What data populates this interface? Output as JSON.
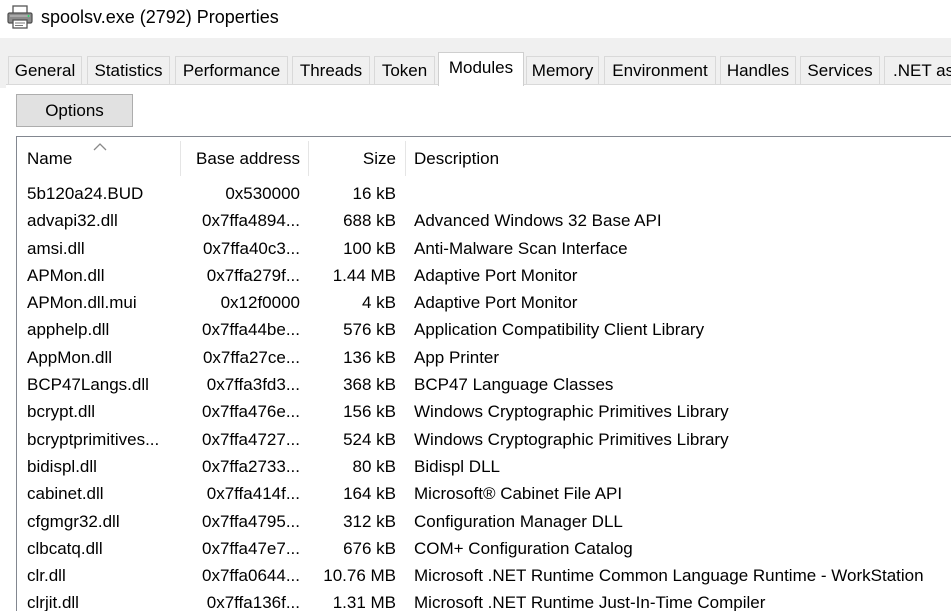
{
  "window": {
    "title": "spoolsv.exe (2792) Properties",
    "icon": "printer-icon"
  },
  "tabs": [
    {
      "label": "General",
      "active": false
    },
    {
      "label": "Statistics",
      "active": false
    },
    {
      "label": "Performance",
      "active": false
    },
    {
      "label": "Threads",
      "active": false
    },
    {
      "label": "Token",
      "active": false
    },
    {
      "label": "Modules",
      "active": true
    },
    {
      "label": "Memory",
      "active": false
    },
    {
      "label": "Environment",
      "active": false
    },
    {
      "label": "Handles",
      "active": false
    },
    {
      "label": "Services",
      "active": false
    },
    {
      "label": ".NET as",
      "active": false
    }
  ],
  "toolbar": {
    "options_label": "Options"
  },
  "table": {
    "columns": {
      "name": "Name",
      "base_address": "Base address",
      "size": "Size",
      "description": "Description"
    },
    "sort_indicator": "sort-ascending-icon",
    "rows": [
      {
        "name": "5b120a24.BUD",
        "base": "0x530000",
        "size": "16 kB",
        "description": ""
      },
      {
        "name": "advapi32.dll",
        "base": "0x7ffa4894...",
        "size": "688 kB",
        "description": "Advanced Windows 32 Base API"
      },
      {
        "name": "amsi.dll",
        "base": "0x7ffa40c3...",
        "size": "100 kB",
        "description": "Anti-Malware Scan Interface"
      },
      {
        "name": "APMon.dll",
        "base": "0x7ffa279f...",
        "size": "1.44 MB",
        "description": "Adaptive Port Monitor"
      },
      {
        "name": "APMon.dll.mui",
        "base": "0x12f0000",
        "size": "4 kB",
        "description": "Adaptive Port Monitor"
      },
      {
        "name": "apphelp.dll",
        "base": "0x7ffa44be...",
        "size": "576 kB",
        "description": "Application Compatibility Client Library"
      },
      {
        "name": "AppMon.dll",
        "base": "0x7ffa27ce...",
        "size": "136 kB",
        "description": "App Printer"
      },
      {
        "name": "BCP47Langs.dll",
        "base": "0x7ffa3fd3...",
        "size": "368 kB",
        "description": "BCP47 Language Classes"
      },
      {
        "name": "bcrypt.dll",
        "base": "0x7ffa476e...",
        "size": "156 kB",
        "description": "Windows Cryptographic Primitives Library"
      },
      {
        "name": "bcryptprimitives...",
        "base": "0x7ffa4727...",
        "size": "524 kB",
        "description": "Windows Cryptographic Primitives Library"
      },
      {
        "name": "bidispl.dll",
        "base": "0x7ffa2733...",
        "size": "80 kB",
        "description": "Bidispl DLL"
      },
      {
        "name": "cabinet.dll",
        "base": "0x7ffa414f...",
        "size": "164 kB",
        "description": "Microsoft® Cabinet File API"
      },
      {
        "name": "cfgmgr32.dll",
        "base": "0x7ffa4795...",
        "size": "312 kB",
        "description": "Configuration Manager DLL"
      },
      {
        "name": "clbcatq.dll",
        "base": "0x7ffa47e7...",
        "size": "676 kB",
        "description": "COM+ Configuration Catalog"
      },
      {
        "name": "clr.dll",
        "base": "0x7ffa0644...",
        "size": "10.76 MB",
        "description": "Microsoft .NET Runtime Common Language Runtime - WorkStation"
      },
      {
        "name": "clrjit.dll",
        "base": "0x7ffa136f...",
        "size": "1.31 MB",
        "description": "Microsoft .NET Runtime Just-In-Time Compiler"
      }
    ]
  }
}
